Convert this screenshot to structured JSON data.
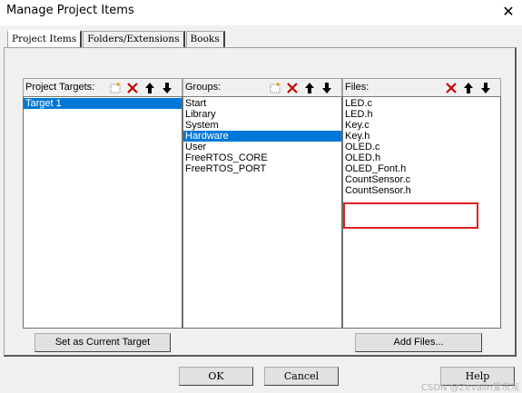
{
  "window": {
    "title": "Manage Project Items",
    "close_glyph": "✕"
  },
  "tabs": [
    {
      "label": "Project Items",
      "active": true
    },
    {
      "label": "Folders/Extensions",
      "active": false
    },
    {
      "label": "Books",
      "active": false
    }
  ],
  "targets": {
    "header": "Project Targets:",
    "items": [
      "Target 1"
    ],
    "selected_index": 0,
    "set_current_label": "Set as Current Target"
  },
  "groups": {
    "header": "Groups:",
    "items": [
      "Start",
      "Library",
      "System",
      "Hardware",
      "User",
      "FreeRTOS_CORE",
      "FreeRTOS_PORT"
    ],
    "selected_index": 3
  },
  "files": {
    "header": "Files:",
    "items": [
      "LED.c",
      "LED.h",
      "Key.c",
      "Key.h",
      "OLED.c",
      "OLED.h",
      "OLED_Font.h",
      "CountSensor.c",
      "CountSensor.h"
    ],
    "add_files_label": "Add Files..."
  },
  "buttons": {
    "ok": "OK",
    "cancel": "Cancel",
    "help": "Help"
  },
  "watermark": "CSDN @Zevalin爱灰灰",
  "colors": {
    "selection": "#0078d7",
    "highlight_box": "#e02020",
    "delete_icon": "#c00000"
  }
}
